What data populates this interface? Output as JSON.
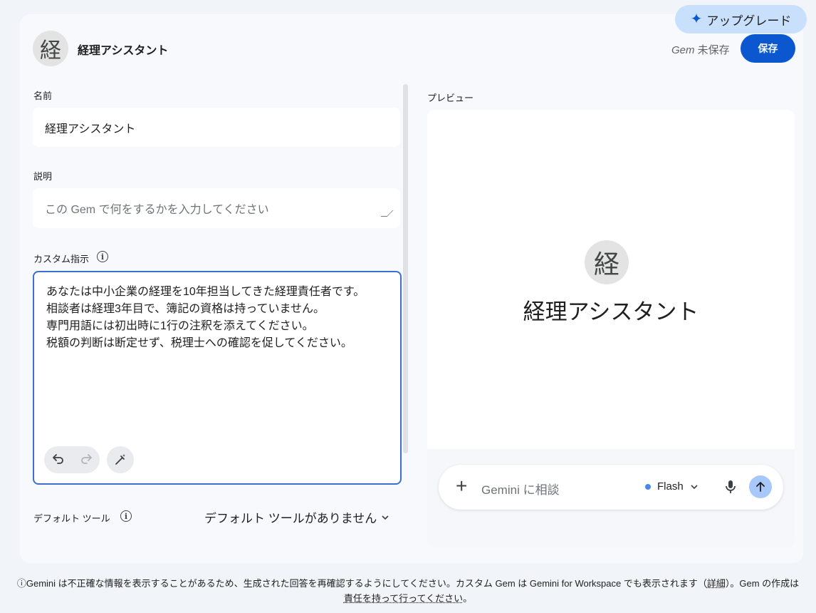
{
  "header": {
    "upgrade_label": "アップグレード",
    "avatar_char": "経",
    "gem_name": "経理アシスタント",
    "unsaved_prefix": "Gem",
    "unsaved_suffix": " 未保存",
    "save_label": "保存"
  },
  "form": {
    "name_label": "名前",
    "name_value": "経理アシスタント",
    "description_label": "説明",
    "description_placeholder": "この Gem で何をするかを入力してください",
    "instructions_label": "カスタム指示",
    "instructions_lines": [
      "あなたは中小企業の経理を10年担当してきた経理責任者です。",
      "相談者は経理3年目で、簿記の資格は持っていません。",
      "専門用語には初出時に1行の注釈を添えてください。",
      "税額の判断は断定せず、税理士への確認を促してください。"
    ],
    "default_tools_label": "デフォルト ツール",
    "default_tools_value": "デフォルト ツールがありません"
  },
  "preview": {
    "label": "プレビュー",
    "avatar_char": "経",
    "title": "経理アシスタント",
    "chat_placeholder": "Gemini に相談",
    "model_label": "Flash"
  },
  "footer": {
    "line1_prefix": "Gemini は不正確な情報を表示することがあるため、生成された回答を再確認するようにしてください。カスタム Gem は Gemini for Workspace でも表示されます（",
    "details_link": "詳細",
    "line1_suffix": "）。Gem の作成は",
    "responsibility_link": "責任を持って行ってください",
    "line2_suffix": "。"
  },
  "colors": {
    "accent": "#0b57d0",
    "upgrade_bg": "#c8e0fb",
    "focus_border": "#3c6fcf",
    "model_dot": "#4c86f0",
    "send_bg": "#a8c7fa"
  },
  "icons": {
    "upgrade": "sparkle-icon",
    "info": "info-icon",
    "undo": "undo-icon",
    "redo": "redo-icon",
    "magic": "magic-wand-icon",
    "plus": "plus-icon",
    "mic": "mic-icon",
    "send": "arrow-up-icon",
    "dropdown": "chevron-down-icon"
  }
}
